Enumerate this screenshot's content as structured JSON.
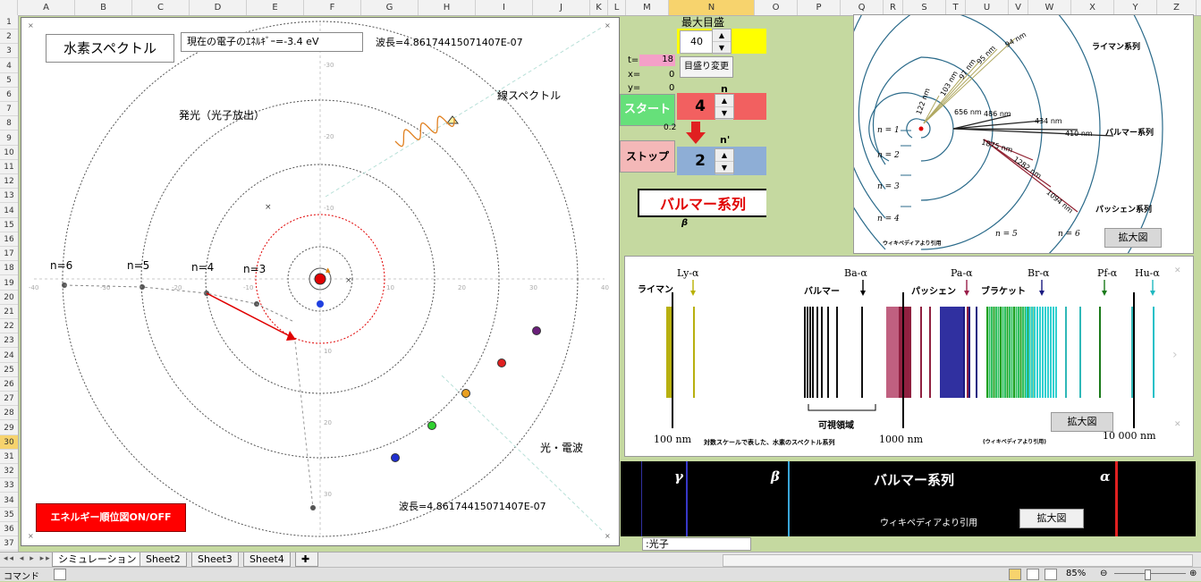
{
  "columns": [
    "A",
    "B",
    "C",
    "D",
    "E",
    "F",
    "G",
    "H",
    "I",
    "J",
    "K",
    "L",
    "M",
    "N",
    "O",
    "P",
    "Q",
    "R",
    "S",
    "T",
    "U",
    "V",
    "W",
    "X",
    "Y",
    "Z"
  ],
  "selected_column": "N",
  "rows": [
    "1",
    "2",
    "3",
    "4",
    "5",
    "6",
    "7",
    "8",
    "9",
    "10",
    "11",
    "12",
    "13",
    "14",
    "15",
    "16",
    "17",
    "18",
    "19",
    "20",
    "21",
    "22",
    "23",
    "24",
    "25",
    "26",
    "27",
    "28",
    "29",
    "30",
    "31",
    "32",
    "33",
    "34",
    "35",
    "36",
    "37"
  ],
  "selected_row": "30",
  "sim": {
    "title": "水素スペクトル",
    "energy_text": "現在の電子のｴﾈﾙｷﾞｰ=-3.4 eV",
    "wavelength_top": "波長=4.86174415071407E-07",
    "wavelength_bottom": "波長=4.86174415071407E-07",
    "emission_label": "発光（光子放出）",
    "line_spectrum_label": "線スペクトル",
    "light_label": "光・電波",
    "energy_button": "エネルギー順位図ON/OFF",
    "orbit_labels": [
      "n=6",
      "n=5",
      "n=4",
      "n=3"
    ],
    "axis_ticks": [
      "-40",
      "-30",
      "-20",
      "-10",
      "10",
      "20",
      "30",
      "40"
    ],
    "axis_ticks_v": [
      "40",
      "30",
      "20",
      "10",
      "-10",
      "-20",
      "-30",
      "-40"
    ]
  },
  "controls": {
    "max_scale_label": "最大目盛",
    "max_scale_value": "40",
    "t_label": "t=",
    "t_value": "18",
    "x_label": "x=",
    "x_value": "0",
    "y_label": "y=",
    "y_value": "0",
    "scale_change_button": "目盛り変更",
    "n_label": "n",
    "n_value": "4",
    "n_prime_label": "n'",
    "n_prime_value": "2",
    "small_value": "0.2",
    "start_button": "スタート",
    "stop_button": "ストップ",
    "series_name": "バルマー系列",
    "series_symbol": "β"
  },
  "diagram": {
    "lyman": "ライマン系列",
    "balmer": "バルマー系列",
    "paschen": "パッシェン系列",
    "levels": [
      "n = 1",
      "n = 2",
      "n = 3",
      "n = 4",
      "n = 5",
      "n = 6"
    ],
    "wavelengths": [
      "94 nm",
      "95 nm",
      "97 nm",
      "103 nm",
      "122 nm",
      "656 nm",
      "486 nm",
      "434 nm",
      "410 nm",
      "1875 nm",
      "1282 nm",
      "1094 nm"
    ],
    "credit": "ウィキペディアより引用",
    "zoom_button": "拡大図"
  },
  "spectrum": {
    "labels": [
      "Ly-α",
      "Ba-α",
      "Pa-α",
      "Br-α",
      "Pf-α",
      "Hu-α"
    ],
    "label_colors": [
      "#b8b000",
      "#000000",
      "#9a1f4a",
      "#1a1a80",
      "#1a7a1a",
      "#20b8c0"
    ],
    "series": [
      "ライマン",
      "バルマー",
      "パッシェン",
      "ブラケット"
    ],
    "visible_label": "可視領域",
    "axis": [
      "100 nm",
      "1000 nm",
      "10 000 nm"
    ],
    "caption": "対数スケールで表した、水素のスペクトル系列",
    "credit": "(ウィキペディアより引用)",
    "zoom_button": "拡大図"
  },
  "balmer_bar": {
    "title": "バルマー系列",
    "gamma": "γ",
    "beta": "β",
    "alpha": "α",
    "credit": "ウィキペディアより引用",
    "zoom_button": "拡大図"
  },
  "cell_photon": ":光子",
  "sheet_tabs": [
    "シミュレーション",
    "Sheet2",
    "Sheet3",
    "Sheet4"
  ],
  "status": {
    "mode": "コマンド",
    "zoom": "85%"
  }
}
